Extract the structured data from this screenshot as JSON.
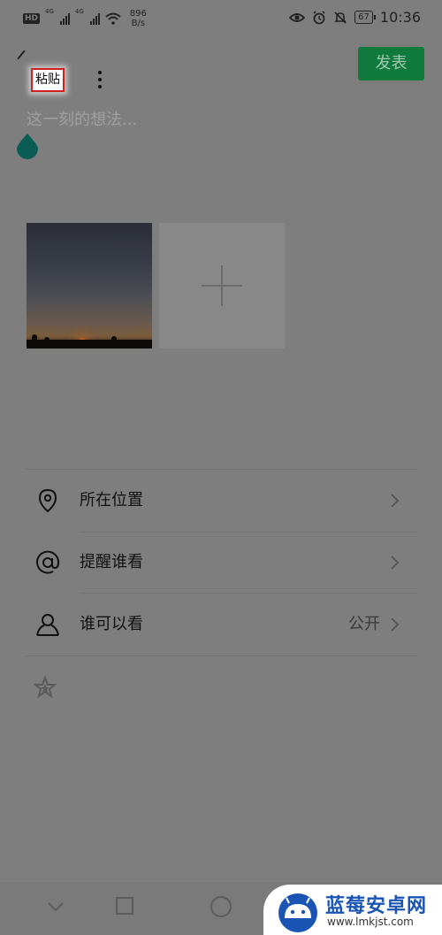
{
  "status_bar": {
    "hd_badge": "HD",
    "signal1_label": "4G",
    "signal2_label": "4G",
    "net_speed_value": "896",
    "net_speed_unit": "B/s",
    "battery": "67",
    "time": "10:36"
  },
  "toolbar": {
    "paste_label": "粘贴",
    "publish_label": "发表"
  },
  "composer": {
    "placeholder": "这一刻的想法..."
  },
  "options": {
    "location_label": "所在位置",
    "mention_label": "提醒谁看",
    "visibility_label": "谁可以看",
    "visibility_value": "公开"
  },
  "watermark": {
    "title": "蓝莓安卓网",
    "url": "www.lmkjst.com"
  },
  "colors": {
    "publish_green": "#0f7a3c",
    "overlay_gray": "#7e7e7e",
    "highlight_red": "#d02020",
    "handle_teal": "#0b5c55",
    "watermark_blue": "#1a55b4"
  }
}
